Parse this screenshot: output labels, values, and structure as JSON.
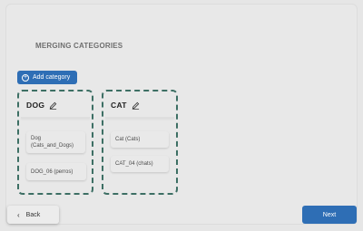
{
  "page": {
    "title": "MERGING CATEGORIES"
  },
  "toolbar": {
    "add_category_label": "Add category",
    "add_icon": "plus-circle-icon"
  },
  "categories": [
    {
      "name": "DOG",
      "edit_icon": "pencil-icon",
      "items": [
        "Dog (Cats_and_Dogs)",
        "DOG_06 (perros)"
      ]
    },
    {
      "name": "CAT",
      "edit_icon": "pencil-icon",
      "items": [
        "Cat (Cats)",
        "CAT_04 (chats)"
      ]
    }
  ],
  "footer": {
    "back_label": "Back",
    "back_icon": "chevron-left-icon",
    "next_label": "Next"
  },
  "colors": {
    "accent": "#2e6eb5",
    "card_border": "#3d6f64",
    "background": "#e6e6e6"
  }
}
